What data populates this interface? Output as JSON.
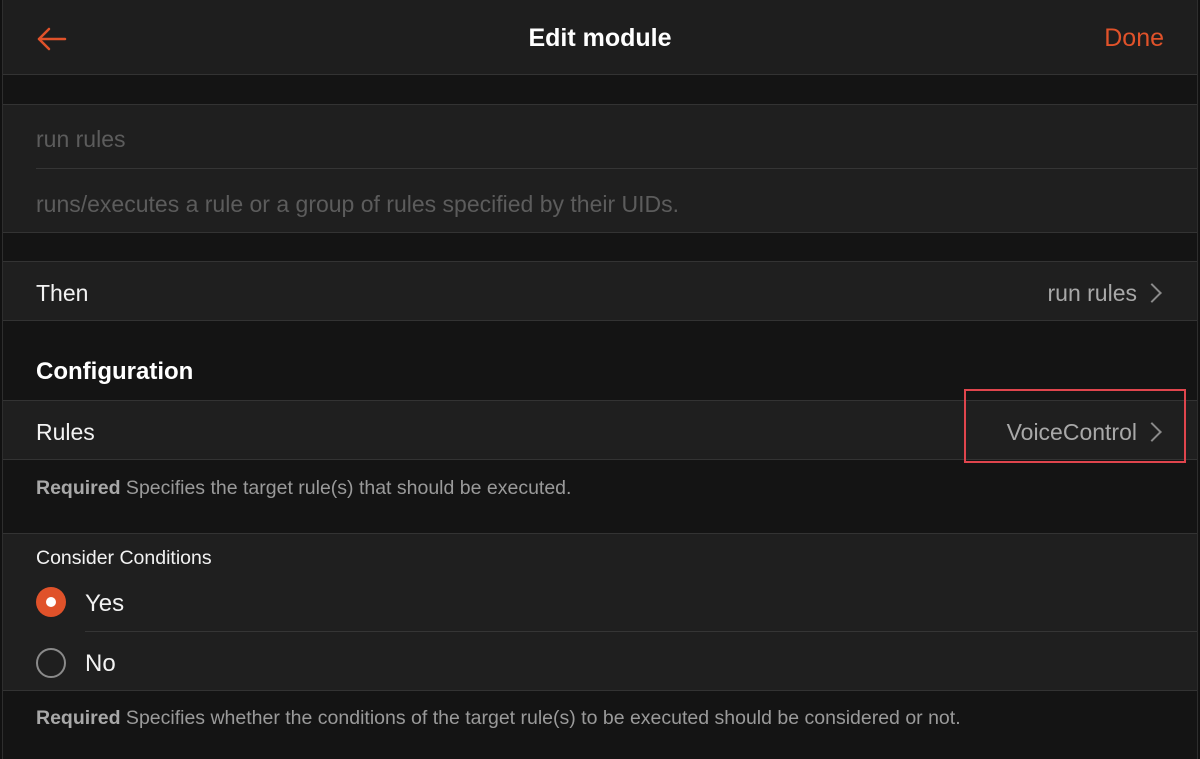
{
  "navbar": {
    "title": "Edit module",
    "done_label": "Done",
    "back_icon": "arrow-left-icon",
    "accent_color": "#e0522a"
  },
  "module": {
    "label_placeholder": "run rules",
    "description_placeholder": "runs/executes a rule or a group of rules specified by their UIDs."
  },
  "then_row": {
    "label": "Then",
    "value": "run rules"
  },
  "configuration": {
    "header": "Configuration",
    "rules": {
      "label": "Rules",
      "value": "VoiceControl",
      "footnote_required": "Required",
      "footnote_text": " Specifies the target rule(s) that should be executed."
    },
    "consider_conditions": {
      "label": "Consider Conditions",
      "options": [
        {
          "label": "Yes",
          "selected": true
        },
        {
          "label": "No",
          "selected": false
        }
      ],
      "footnote_required": "Required",
      "footnote_text": " Specifies whether the conditions of the target rule(s) to be executed should be considered or not."
    }
  }
}
